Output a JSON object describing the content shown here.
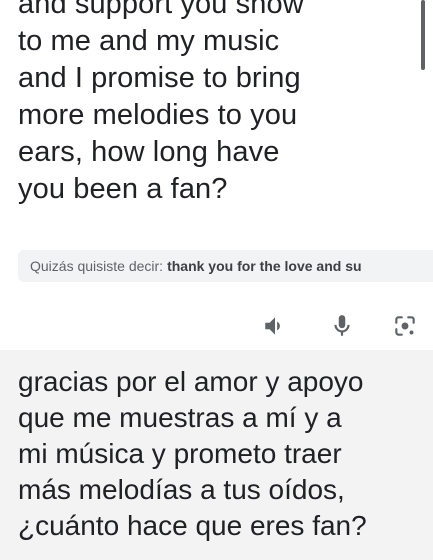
{
  "source": {
    "text": "and support you show\nto me and my music\nand I promise to bring\nmore melodies to you\nears, how long have\nyou been a fan?"
  },
  "suggestion": {
    "prefix": "Quizás quisiste decir:",
    "suggested_text": "thank you for the love and su"
  },
  "actions": {
    "icons": [
      "speaker-icon",
      "microphone-icon",
      "camera-lens-icon"
    ]
  },
  "translation": {
    "text": "gracias por el amor y apoyo\nque me muestras a mí y a\nmi música y prometo traer\nmás melodías a tus oídos,\n¿cuánto hace que eres fan?"
  },
  "colors": {
    "text": "#202124",
    "icon": "#5f6368",
    "suggestion_bg": "#f1f3f4",
    "translation_bg": "#f3f3f3"
  }
}
